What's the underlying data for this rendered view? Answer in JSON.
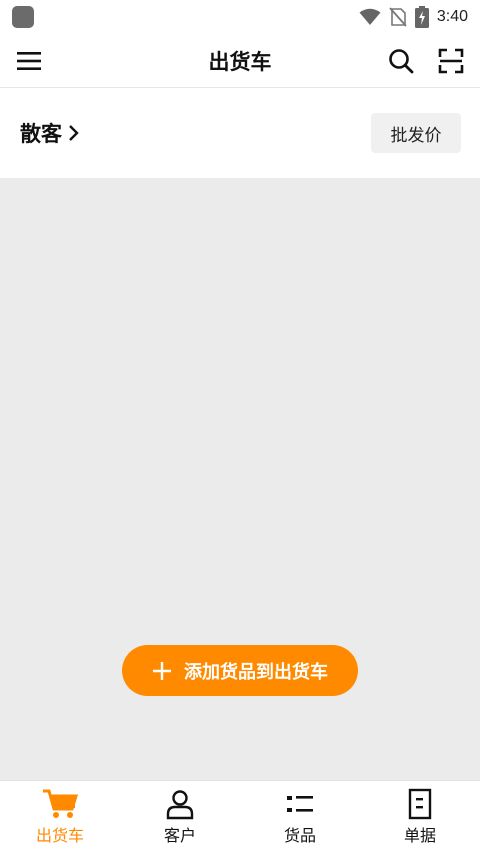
{
  "status_bar": {
    "time": "3:40"
  },
  "app_bar": {
    "title": "出货车"
  },
  "customer": {
    "name": "散客",
    "price_type": "批发价"
  },
  "add_goods": {
    "label": "添加货品到出货车"
  },
  "bottom_nav": {
    "items": [
      {
        "label": "出货车",
        "icon": "cart-icon",
        "active": true
      },
      {
        "label": "客户",
        "icon": "person-icon",
        "active": false
      },
      {
        "label": "货品",
        "icon": "list-icon",
        "active": false
      },
      {
        "label": "单据",
        "icon": "document-icon",
        "active": false
      }
    ]
  },
  "colors": {
    "accent": "#ff8a00",
    "content_bg": "#ebebeb"
  }
}
